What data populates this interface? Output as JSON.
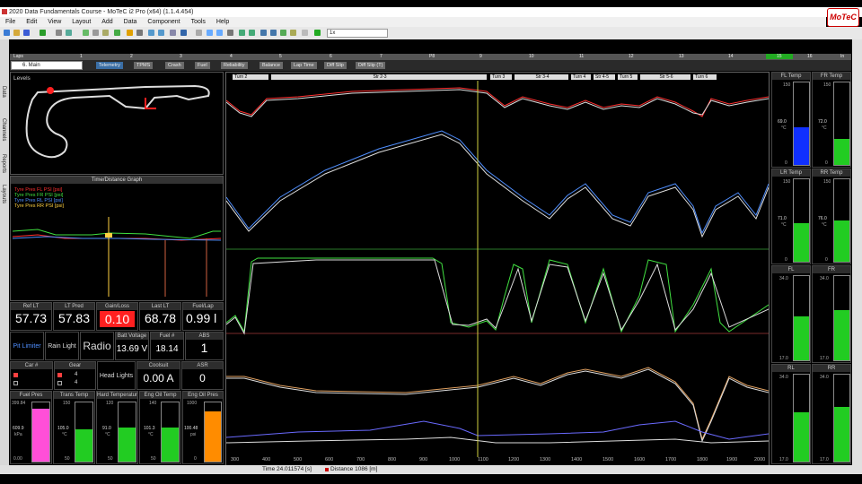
{
  "window": {
    "title": "2020 Data Fundamentals Course - MoTeC i2 Pro (x64) (1.1.4.454)",
    "logo": "MoTeC"
  },
  "menu": [
    "File",
    "Edit",
    "View",
    "Layout",
    "Add",
    "Data",
    "Component",
    "Tools",
    "Help"
  ],
  "toolbar": {
    "zoom": "1x"
  },
  "left_tabs": [
    "Data",
    "Channels",
    "Reports",
    "Layouts"
  ],
  "laps": {
    "label": "Laps",
    "numbers": [
      "1",
      "2",
      "3",
      "4",
      "5",
      "6",
      "7",
      "P8",
      "9",
      "10",
      "11",
      "12",
      "13",
      "14",
      "15",
      "16",
      "In"
    ]
  },
  "worksheet_tabs": {
    "selected": "6. Main",
    "tabs": [
      "Telemetry",
      "TPMS",
      "Crash",
      "Fuel",
      "Reliability",
      "Balance",
      "Lap Time",
      "Diff Slip",
      "Diff Slip (T)"
    ]
  },
  "levels": {
    "title": "Levels"
  },
  "time_distance": {
    "title": "Time/Distance Graph",
    "legend": [
      "Tyre Pres FL PSI [psi]",
      "Tyre Pres FR PSI [psi]",
      "Tyre Pres RL PSI [psi]",
      "Tyre Pres RR PSI [psi]"
    ],
    "legend_colors": [
      "#ff3030",
      "#40e040",
      "#4f8fff",
      "#ffd040"
    ]
  },
  "values": [
    {
      "label": "Ref LT",
      "value": "57.73"
    },
    {
      "label": "LT Pred",
      "value": "57.83"
    },
    {
      "label": "Gain/Loss",
      "value": "0.10"
    },
    {
      "label": "Last LT",
      "value": "68.78"
    },
    {
      "label": "Fuel/Lap",
      "value": "0.99 l"
    }
  ],
  "indicators": {
    "pit_limiter": "Pit Limiter",
    "rain_light": "Rain Light",
    "radio": "Radio",
    "batt_label": "Batt Voltage",
    "batt_value": "13.69 V",
    "fuel_label": "Fuel #",
    "fuel_value": "18.14",
    "abs_label": "ABS",
    "abs_value": "1",
    "car_label": "Car #",
    "gear_label": "Gear",
    "gear_values": [
      "4",
      "4"
    ],
    "headlights": "Head Lights",
    "coolsuit_label": "Coolsuit",
    "coolsuit_value": "0.00 A",
    "asr_label": "ASR",
    "asr_value": "0"
  },
  "bottom_gauges": [
    {
      "label": "Fuel Pres",
      "max": "399.84",
      "value": "609.9",
      "unit": "kPa",
      "min": "0.00",
      "color": "#ff4fd8",
      "fill": 0.9
    },
    {
      "label": "Trans Temp",
      "max": "150",
      "value": "105.0",
      "unit": "°C",
      "min": "50",
      "color": "#22cc22",
      "fill": 0.55
    },
    {
      "label": "Hard Temperature",
      "max": "120",
      "value": "91.0",
      "unit": "°C",
      "min": "50",
      "color": "#22cc22",
      "fill": 0.58
    },
    {
      "label": "Eng Oil Temp",
      "max": "140",
      "value": "101.3",
      "unit": "°C",
      "min": "50",
      "color": "#22cc22",
      "fill": 0.57
    },
    {
      "label": "Eng Oil Pres",
      "max": "1000",
      "value": "100.48",
      "unit": "psi",
      "min": "0",
      "color": "#ff8c00",
      "fill": 0.85
    }
  ],
  "segments": [
    {
      "label": "Turn 2"
    },
    {
      "label": "Str 2-3"
    },
    {
      "label": "Turn 3"
    },
    {
      "label": "Str 3-4"
    },
    {
      "label": "Turn 4"
    },
    {
      "label": "Str 4-5"
    },
    {
      "label": "Turn 5"
    },
    {
      "label": "Str 5-6"
    },
    {
      "label": "Turn 6"
    }
  ],
  "x_axis": [
    "300",
    "400",
    "500",
    "600",
    "700",
    "800",
    "900",
    "1000",
    "1100",
    "1200",
    "1300",
    "1400",
    "1500",
    "1600",
    "1700",
    "1800",
    "1900",
    "2000"
  ],
  "status": {
    "time": "Time  24.011574 [s]",
    "distance": "Distance  1086 [m]"
  },
  "tyre_temps": [
    {
      "label": "FL Temp",
      "max": "150",
      "value": "69.0",
      "unit": "°C",
      "min": "0",
      "color": "#1030ff",
      "fill": 0.46
    },
    {
      "label": "FR Temp",
      "max": "150",
      "value": "72.0",
      "unit": "°C",
      "min": "0",
      "color": "#22cc22",
      "fill": 0.32
    },
    {
      "label": "LR Temp",
      "max": "150",
      "value": "71.0",
      "unit": "°C",
      "min": "0",
      "color": "#22cc22",
      "fill": 0.47
    },
    {
      "label": "RR Temp",
      "max": "150",
      "value": "76.0",
      "unit": "°C",
      "min": "0",
      "color": "#22cc22",
      "fill": 0.5
    }
  ],
  "tyre_pres": [
    {
      "label": "FL",
      "max": "34.0",
      "min": "17.0",
      "color": "#22cc22",
      "fill": 0.52
    },
    {
      "label": "FR",
      "max": "34.0",
      "min": "17.0",
      "color": "#22cc22",
      "fill": 0.6
    },
    {
      "label": "RL",
      "max": "34.0",
      "min": "17.0",
      "color": "#22cc22",
      "fill": 0.57
    },
    {
      "label": "RR",
      "max": "34.0",
      "min": "17.0",
      "color": "#22cc22",
      "fill": 0.63
    }
  ]
}
